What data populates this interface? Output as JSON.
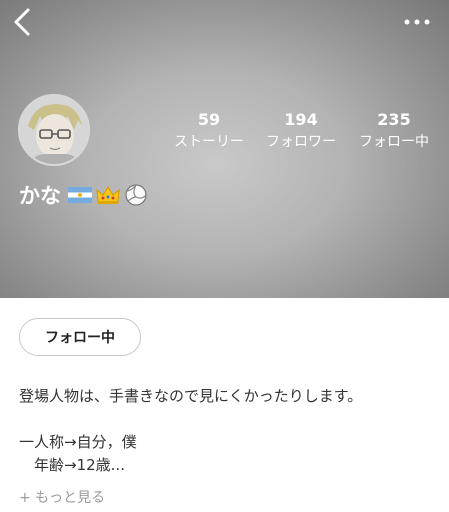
{
  "profile": {
    "name": "かな",
    "badges": [
      "argentina-flag-emoji",
      "crown-emoji",
      "volleyball-emoji"
    ],
    "stats": [
      {
        "value": "59",
        "label": "ストーリー"
      },
      {
        "value": "194",
        "label": "フォロワー"
      },
      {
        "value": "235",
        "label": "フォロー中"
      }
    ],
    "follow_button": "フォロー中",
    "bio": {
      "line1": "登場人物は、手書きなので見にくかったりします。",
      "line2": "一人称→自分，僕",
      "line3": "　年齢→12歳...",
      "more": "+ もっと見る"
    }
  },
  "icons": {
    "back": "chevron-left-icon",
    "more": "more-horizontal-icon"
  }
}
